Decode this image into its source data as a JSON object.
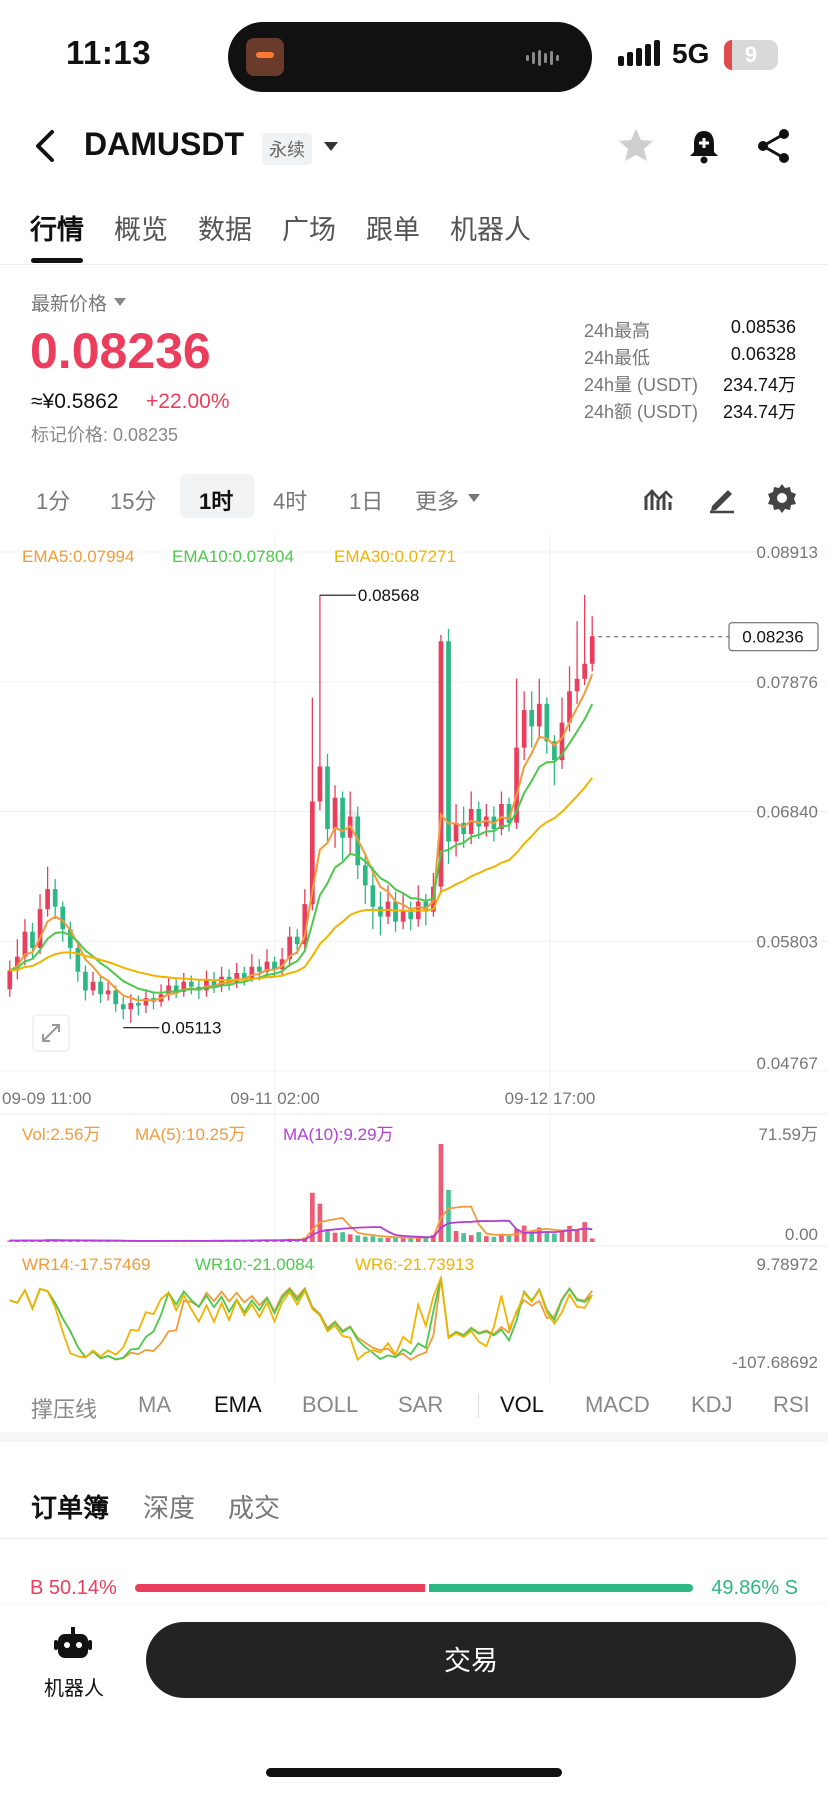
{
  "status": {
    "time": "11:13",
    "network": "5G",
    "battery": "9"
  },
  "header": {
    "symbol": "DAMUSDT",
    "tag": "永续"
  },
  "tabs": [
    "行情",
    "概览",
    "数据",
    "广场",
    "跟单",
    "机器人"
  ],
  "price": {
    "label": "最新价格",
    "last": "0.08236",
    "cny": "≈¥0.5862",
    "change": "+22.00%",
    "mark": "标记价格: 0.08235"
  },
  "stats": [
    {
      "label": "24h最高",
      "value": "0.08536"
    },
    {
      "label": "24h最低",
      "value": "0.06328"
    },
    {
      "label": "24h量 (USDT)",
      "value": "234.74万"
    },
    {
      "label": "24h额 (USDT)",
      "value": "234.74万"
    }
  ],
  "intervals": [
    "1分",
    "15分",
    "1时",
    "4时",
    "1日",
    "更多"
  ],
  "chart_data": {
    "type": "candlestick",
    "ema_legend": [
      "EMA5:0.07994",
      "EMA10:0.07804",
      "EMA30:0.07271"
    ],
    "ema_colors": [
      "#f29b3a",
      "#4cc94c",
      "#f0b400"
    ],
    "y_ticks": [
      "0.08913",
      "0.07876",
      "0.06840",
      "0.05803",
      "0.04767"
    ],
    "ylim": [
      0.04767,
      0.08913
    ],
    "x_ticks": [
      "09-09 11:00",
      "09-11 02:00",
      "09-12 17:00"
    ],
    "high_label": "0.08568",
    "low_label": "0.05113",
    "last_price_label": "0.08236",
    "colors": {
      "up": "#ea3e5c",
      "down": "#2db883"
    },
    "candles": [
      [
        0.0542,
        0.0557,
        0.0565,
        0.0536
      ],
      [
        0.0557,
        0.0568,
        0.0582,
        0.055
      ],
      [
        0.0568,
        0.0588,
        0.0598,
        0.0561
      ],
      [
        0.0588,
        0.0575,
        0.0595,
        0.0566
      ],
      [
        0.0575,
        0.0606,
        0.0618,
        0.057
      ],
      [
        0.0606,
        0.0622,
        0.064,
        0.06
      ],
      [
        0.0622,
        0.0608,
        0.063,
        0.0598
      ],
      [
        0.0608,
        0.059,
        0.0612,
        0.058
      ],
      [
        0.059,
        0.0575,
        0.0596,
        0.0566
      ],
      [
        0.0575,
        0.0556,
        0.058,
        0.0548
      ],
      [
        0.0556,
        0.0541,
        0.0561,
        0.0533
      ],
      [
        0.0541,
        0.0548,
        0.0556,
        0.0537
      ],
      [
        0.0548,
        0.0538,
        0.0552,
        0.0531
      ],
      [
        0.0538,
        0.0541,
        0.0549,
        0.0533
      ],
      [
        0.0541,
        0.053,
        0.0545,
        0.0524
      ],
      [
        0.053,
        0.0526,
        0.0536,
        0.0518
      ],
      [
        0.0526,
        0.0531,
        0.0538,
        0.0515
      ],
      [
        0.0531,
        0.0529,
        0.0537,
        0.0521
      ],
      [
        0.0529,
        0.0535,
        0.0542,
        0.0523
      ],
      [
        0.0535,
        0.0532,
        0.054,
        0.0526
      ],
      [
        0.0532,
        0.0538,
        0.0546,
        0.0528
      ],
      [
        0.0538,
        0.0545,
        0.0552,
        0.0533
      ],
      [
        0.0545,
        0.054,
        0.055,
        0.0535
      ],
      [
        0.054,
        0.0548,
        0.0555,
        0.0536
      ],
      [
        0.0548,
        0.0544,
        0.0553,
        0.0538
      ],
      [
        0.0544,
        0.0541,
        0.0549,
        0.0534
      ],
      [
        0.0541,
        0.0549,
        0.0557,
        0.0536
      ],
      [
        0.0549,
        0.0545,
        0.0556,
        0.0539
      ],
      [
        0.0545,
        0.0552,
        0.056,
        0.054
      ],
      [
        0.0552,
        0.0547,
        0.0558,
        0.0541
      ],
      [
        0.0547,
        0.0555,
        0.0563,
        0.0543
      ],
      [
        0.0555,
        0.0551,
        0.056,
        0.0545
      ],
      [
        0.0551,
        0.056,
        0.057,
        0.0548
      ],
      [
        0.056,
        0.0556,
        0.0566,
        0.0549
      ],
      [
        0.0556,
        0.0564,
        0.0574,
        0.0551
      ],
      [
        0.0564,
        0.0558,
        0.0568,
        0.0552
      ],
      [
        0.0558,
        0.0566,
        0.0575,
        0.0552
      ],
      [
        0.0566,
        0.0584,
        0.0592,
        0.056
      ],
      [
        0.0584,
        0.0578,
        0.059,
        0.057
      ],
      [
        0.0578,
        0.061,
        0.0622,
        0.0572
      ],
      [
        0.061,
        0.0692,
        0.0775,
        0.0605
      ],
      [
        0.0692,
        0.072,
        0.0857,
        0.0685
      ],
      [
        0.072,
        0.067,
        0.073,
        0.066
      ],
      [
        0.067,
        0.0695,
        0.0705,
        0.0655
      ],
      [
        0.0695,
        0.0663,
        0.07,
        0.0645
      ],
      [
        0.0663,
        0.068,
        0.07,
        0.065
      ],
      [
        0.068,
        0.0641,
        0.0688,
        0.063
      ],
      [
        0.0641,
        0.0625,
        0.065,
        0.061
      ],
      [
        0.0625,
        0.0608,
        0.064,
        0.059
      ],
      [
        0.0608,
        0.06,
        0.062,
        0.0585
      ],
      [
        0.06,
        0.0612,
        0.0625,
        0.0594
      ],
      [
        0.0612,
        0.0596,
        0.062,
        0.0588
      ],
      [
        0.0596,
        0.0605,
        0.0618,
        0.059
      ],
      [
        0.0605,
        0.0598,
        0.0612,
        0.0589
      ],
      [
        0.0598,
        0.0612,
        0.0625,
        0.0592
      ],
      [
        0.0612,
        0.0604,
        0.0618,
        0.0593
      ],
      [
        0.0604,
        0.0624,
        0.0635,
        0.06
      ],
      [
        0.0624,
        0.082,
        0.0825,
        0.0618
      ],
      [
        0.082,
        0.066,
        0.083,
        0.0642
      ],
      [
        0.066,
        0.0675,
        0.069,
        0.0648
      ],
      [
        0.0675,
        0.0666,
        0.0688,
        0.0655
      ],
      [
        0.0666,
        0.0686,
        0.07,
        0.0658
      ],
      [
        0.0686,
        0.0672,
        0.0692,
        0.0662
      ],
      [
        0.0672,
        0.068,
        0.069,
        0.0664
      ],
      [
        0.068,
        0.067,
        0.0688,
        0.066
      ],
      [
        0.067,
        0.069,
        0.07,
        0.0665
      ],
      [
        0.069,
        0.0675,
        0.0695,
        0.0668
      ],
      [
        0.0675,
        0.0735,
        0.079,
        0.067
      ],
      [
        0.0735,
        0.0765,
        0.078,
        0.0725
      ],
      [
        0.0765,
        0.0752,
        0.078,
        0.0735
      ],
      [
        0.0752,
        0.077,
        0.079,
        0.0742
      ],
      [
        0.077,
        0.074,
        0.0775,
        0.073
      ],
      [
        0.074,
        0.0725,
        0.0745,
        0.0705
      ],
      [
        0.0725,
        0.0755,
        0.0775,
        0.0718
      ],
      [
        0.0755,
        0.078,
        0.08,
        0.0748
      ],
      [
        0.078,
        0.079,
        0.0836,
        0.077
      ],
      [
        0.079,
        0.0802,
        0.0857,
        0.0785
      ],
      [
        0.0802,
        0.0824,
        0.084,
        0.0796
      ]
    ]
  },
  "volume": {
    "legend": [
      "Vol:2.56万",
      "MA(5):10.25万",
      "MA(10):9.29万"
    ],
    "colors": [
      "#f29b3a",
      "#f29b3a",
      "#b33ed6"
    ],
    "y_ticks": [
      "71.59万",
      "0.00"
    ],
    "max": 71.59,
    "values": [
      1.2,
      0.9,
      1.5,
      0.8,
      1.1,
      2.0,
      1.6,
      0.7,
      0.9,
      1.3,
      1.0,
      0.6,
      0.8,
      1.1,
      0.7,
      0.9,
      0.5,
      0.6,
      0.8,
      0.7,
      1.2,
      0.9,
      0.6,
      0.8,
      1.0,
      0.7,
      0.9,
      1.1,
      0.8,
      1.4,
      0.9,
      1.0,
      1.6,
      1.2,
      1.8,
      1.0,
      1.3,
      2.4,
      1.9,
      3.2,
      36.0,
      28.0,
      9.5,
      6.8,
      7.2,
      5.6,
      4.8,
      3.9,
      4.2,
      3.1,
      2.9,
      3.5,
      2.6,
      3.0,
      4.1,
      3.3,
      5.2,
      71.59,
      38.0,
      8.0,
      6.5,
      5.0,
      7.2,
      4.3,
      3.8,
      6.0,
      4.4,
      9.5,
      12.0,
      8.3,
      10.6,
      7.4,
      6.2,
      8.9,
      11.8,
      9.6,
      14.5,
      2.56
    ]
  },
  "wr": {
    "legend": [
      "WR14:-17.57469",
      "WR10:-21.0084",
      "WR6:-21.73913"
    ],
    "colors": [
      "#f29b3a",
      "#4cc94c",
      "#f0b400"
    ],
    "y_ticks": [
      "9.78972",
      "-107.68692"
    ]
  },
  "indicators": [
    "撑压线",
    "MA",
    "EMA",
    "BOLL",
    "SAR",
    "VOL",
    "MACD",
    "KDJ",
    "RSI"
  ],
  "orderbook": {
    "tabs": [
      "订单簿",
      "深度",
      "成交"
    ],
    "buy": "B 50.14%",
    "sell": "49.86% S",
    "buy_pct": 50.14
  },
  "bottom": {
    "robot_label": "机器人",
    "trade_label": "交易"
  }
}
